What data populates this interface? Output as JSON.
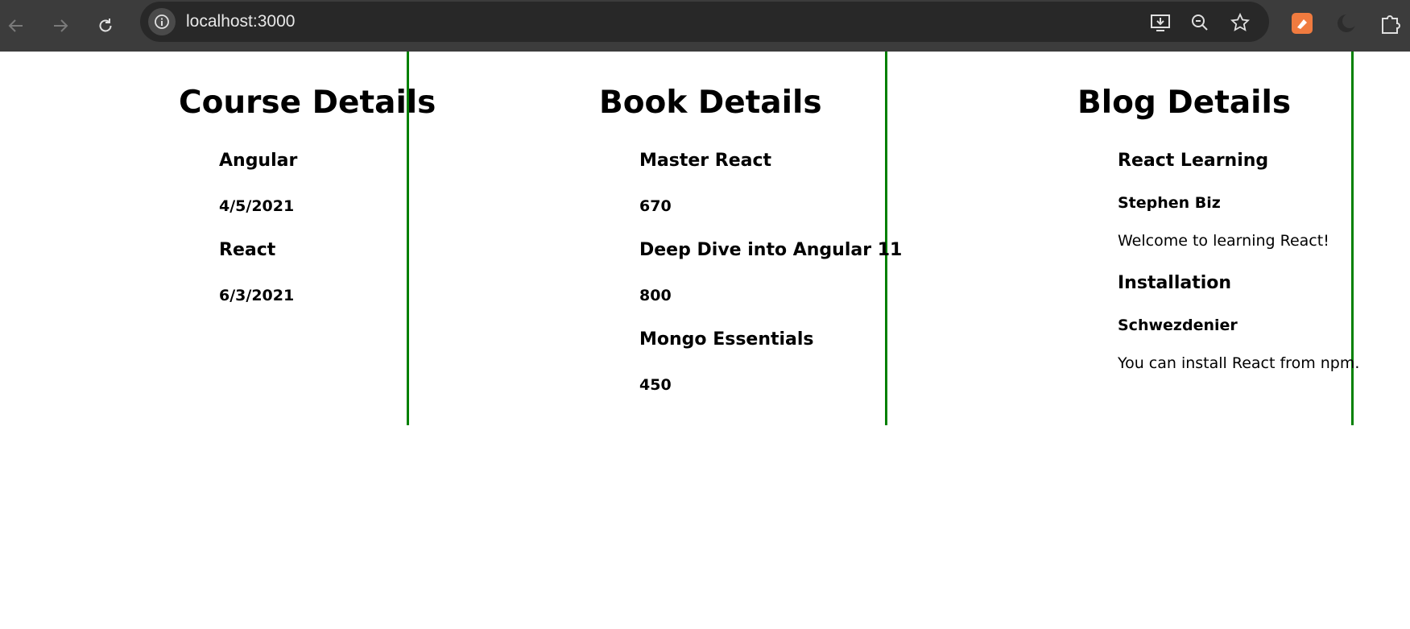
{
  "browser": {
    "url": "localhost:3000",
    "icons": {
      "back": "arrow-left-icon",
      "forward": "arrow-right-icon",
      "reload": "reload-icon",
      "site_info": "info-icon",
      "install": "install-app-icon",
      "zoom": "zoom-out-icon",
      "bookmark": "star-icon",
      "extension": "extension-icon",
      "dark_mode": "moon-icon",
      "extensions_menu": "puzzle-icon"
    },
    "colors": {
      "toolbar": "#3c3c3c",
      "omnibox": "#282828",
      "extension_accent": "#f07b3f"
    }
  },
  "page": {
    "divider_color": "#008000",
    "courses": {
      "title": "Course Details",
      "items": [
        {
          "name": "Angular",
          "date": "4/5/2021"
        },
        {
          "name": "React",
          "date": "6/3/2021"
        }
      ]
    },
    "books": {
      "title": "Book Details",
      "items": [
        {
          "name": "Master React",
          "price": "670"
        },
        {
          "name": "Deep Dive into Angular 11",
          "price": "800"
        },
        {
          "name": "Mongo Essentials",
          "price": "450"
        }
      ]
    },
    "blogs": {
      "title": "Blog Details",
      "items": [
        {
          "title": "React Learning",
          "author": "Stephen Biz",
          "content": "Welcome to learning React!"
        },
        {
          "title": "Installation",
          "author": "Schwezdenier",
          "content": "You can install React from npm."
        }
      ]
    }
  }
}
